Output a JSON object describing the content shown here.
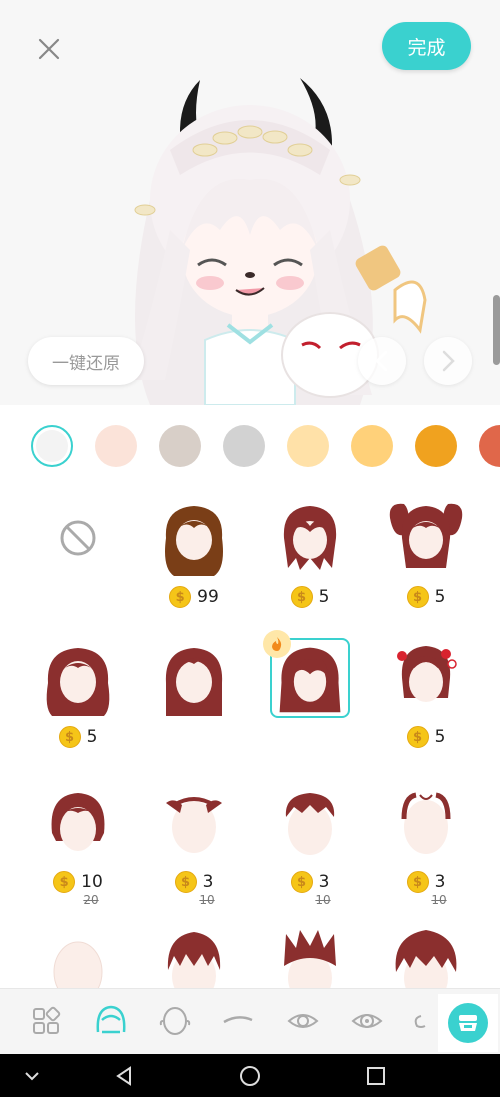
{
  "header": {
    "done_label": "完成",
    "reset_label": "一键还原"
  },
  "icons": {
    "close": "close-icon",
    "prev": "chevron-left-icon",
    "next": "chevron-right-icon"
  },
  "colors": {
    "accent": "#3ad1cf",
    "hair": "#8b2f2e",
    "skin": "#fbeee9",
    "coin": "#f5c518"
  },
  "swatches": [
    {
      "color": "#f3f3f3",
      "selected": true
    },
    {
      "color": "#fbe3d9",
      "selected": false
    },
    {
      "color": "#d8cfc8",
      "selected": false
    },
    {
      "color": "#d2d2d2",
      "selected": false
    },
    {
      "color": "#ffe1a8",
      "selected": false
    },
    {
      "color": "#ffd17a",
      "selected": false
    },
    {
      "color": "#f0a21f",
      "selected": false
    },
    {
      "color": "#e0674a",
      "selected": false
    }
  ],
  "hair_items": [
    {
      "name": "none",
      "price": "",
      "old_price": ""
    },
    {
      "name": "long-wavy-brown",
      "price": "99",
      "old_price": ""
    },
    {
      "name": "shaggy-long",
      "price": "5",
      "old_price": ""
    },
    {
      "name": "pigtails",
      "price": "5",
      "old_price": ""
    },
    {
      "name": "wavy-long",
      "price": "5",
      "old_price": ""
    },
    {
      "name": "straight-long",
      "price": "",
      "old_price": ""
    },
    {
      "name": "layered-long-selected",
      "price": "",
      "old_price": ""
    },
    {
      "name": "flower-bun",
      "price": "5",
      "old_price": ""
    },
    {
      "name": "bob",
      "price": "10",
      "old_price": "20"
    },
    {
      "name": "sideburns-bald",
      "price": "3",
      "old_price": "10"
    },
    {
      "name": "short-messy",
      "price": "3",
      "old_price": "10"
    },
    {
      "name": "receding-combover",
      "price": "3",
      "old_price": "10"
    },
    {
      "name": "bald",
      "price": "",
      "old_price": ""
    },
    {
      "name": "spiky-short",
      "price": "",
      "old_price": ""
    },
    {
      "name": "spiky-up",
      "price": "",
      "old_price": ""
    },
    {
      "name": "fluffy-spiky",
      "price": "",
      "old_price": ""
    }
  ],
  "tabs": [
    {
      "icon": "grid-icon",
      "active": false
    },
    {
      "icon": "hair-icon",
      "active": true
    },
    {
      "icon": "face-shape-icon",
      "active": false
    },
    {
      "icon": "eyebrow-icon",
      "active": false
    },
    {
      "icon": "eye-icon",
      "active": false
    },
    {
      "icon": "eye-detail-icon",
      "active": false
    },
    {
      "icon": "ear-icon",
      "active": false
    },
    {
      "icon": "beard-icon",
      "active": true
    }
  ],
  "system_nav": [
    "chevron-down-icon",
    "back-icon",
    "home-icon",
    "recents-icon"
  ]
}
